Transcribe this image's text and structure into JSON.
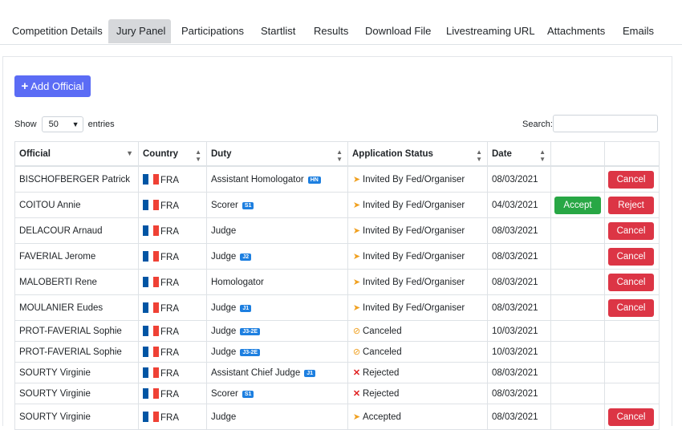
{
  "tabs": [
    "Competition Details",
    "Jury Panel",
    "Participations",
    "Startlist",
    "Results",
    "Download File",
    "Livestreaming URL",
    "Attachments",
    "Emails"
  ],
  "active_tab": "Jury Panel",
  "add_button": "Add Official",
  "show_label": "Show",
  "entries_value": "50",
  "entries_label": "entries",
  "search_label": "Search:",
  "columns": [
    "Official",
    "Country",
    "Duty",
    "Application Status",
    "Date"
  ],
  "rows": [
    {
      "name": "BISCHOFBERGER Patrick",
      "country": "FRA",
      "duty": "Assistant Homologator",
      "badge": "HN",
      "status": "Invited By Fed/Organiser",
      "status_type": "invited",
      "date": "08/03/2021",
      "accept": "",
      "action": "Cancel"
    },
    {
      "name": "COITOU Annie",
      "country": "FRA",
      "duty": "Scorer",
      "badge": "S1",
      "status": "Invited By Fed/Organiser",
      "status_type": "invited",
      "date": "04/03/2021",
      "accept": "Accept",
      "action": "Reject"
    },
    {
      "name": "DELACOUR Arnaud",
      "country": "FRA",
      "duty": "Judge",
      "badge": "",
      "status": "Invited By Fed/Organiser",
      "status_type": "invited",
      "date": "08/03/2021",
      "accept": "",
      "action": "Cancel"
    },
    {
      "name": "FAVERIAL Jerome",
      "country": "FRA",
      "duty": "Judge",
      "badge": "J2",
      "status": "Invited By Fed/Organiser",
      "status_type": "invited",
      "date": "08/03/2021",
      "accept": "",
      "action": "Cancel"
    },
    {
      "name": "MALOBERTI Rene",
      "country": "FRA",
      "duty": "Homologator",
      "badge": "",
      "status": "Invited By Fed/Organiser",
      "status_type": "invited",
      "date": "08/03/2021",
      "accept": "",
      "action": "Cancel"
    },
    {
      "name": "MOULANIER Eudes",
      "country": "FRA",
      "duty": "Judge",
      "badge": "J1",
      "status": "Invited By Fed/Organiser",
      "status_type": "invited",
      "date": "08/03/2021",
      "accept": "",
      "action": "Cancel"
    },
    {
      "name": "PROT-FAVERIAL Sophie",
      "country": "FRA",
      "duty": "Judge",
      "badge": "J3-2E",
      "status": "Canceled",
      "status_type": "canceled",
      "date": "10/03/2021",
      "accept": "",
      "action": ""
    },
    {
      "name": "PROT-FAVERIAL Sophie",
      "country": "FRA",
      "duty": "Judge",
      "badge": "J3-2E",
      "status": "Canceled",
      "status_type": "canceled",
      "date": "10/03/2021",
      "accept": "",
      "action": ""
    },
    {
      "name": "SOURTY Virginie",
      "country": "FRA",
      "duty": "Assistant Chief Judge",
      "badge": "J1",
      "status": "Rejected",
      "status_type": "rejected",
      "date": "08/03/2021",
      "accept": "",
      "action": ""
    },
    {
      "name": "SOURTY Virginie",
      "country": "FRA",
      "duty": "Scorer",
      "badge": "S1",
      "status": "Rejected",
      "status_type": "rejected",
      "date": "08/03/2021",
      "accept": "",
      "action": ""
    },
    {
      "name": "SOURTY Virginie",
      "country": "FRA",
      "duty": "Judge",
      "badge": "",
      "status": "Accepted",
      "status_type": "invited",
      "date": "08/03/2021",
      "accept": "",
      "action": "Cancel"
    }
  ],
  "colors": {
    "primary": "#5b6cf5",
    "danger": "#dc3545",
    "success": "#28a745",
    "badge": "#1d7fe0"
  }
}
